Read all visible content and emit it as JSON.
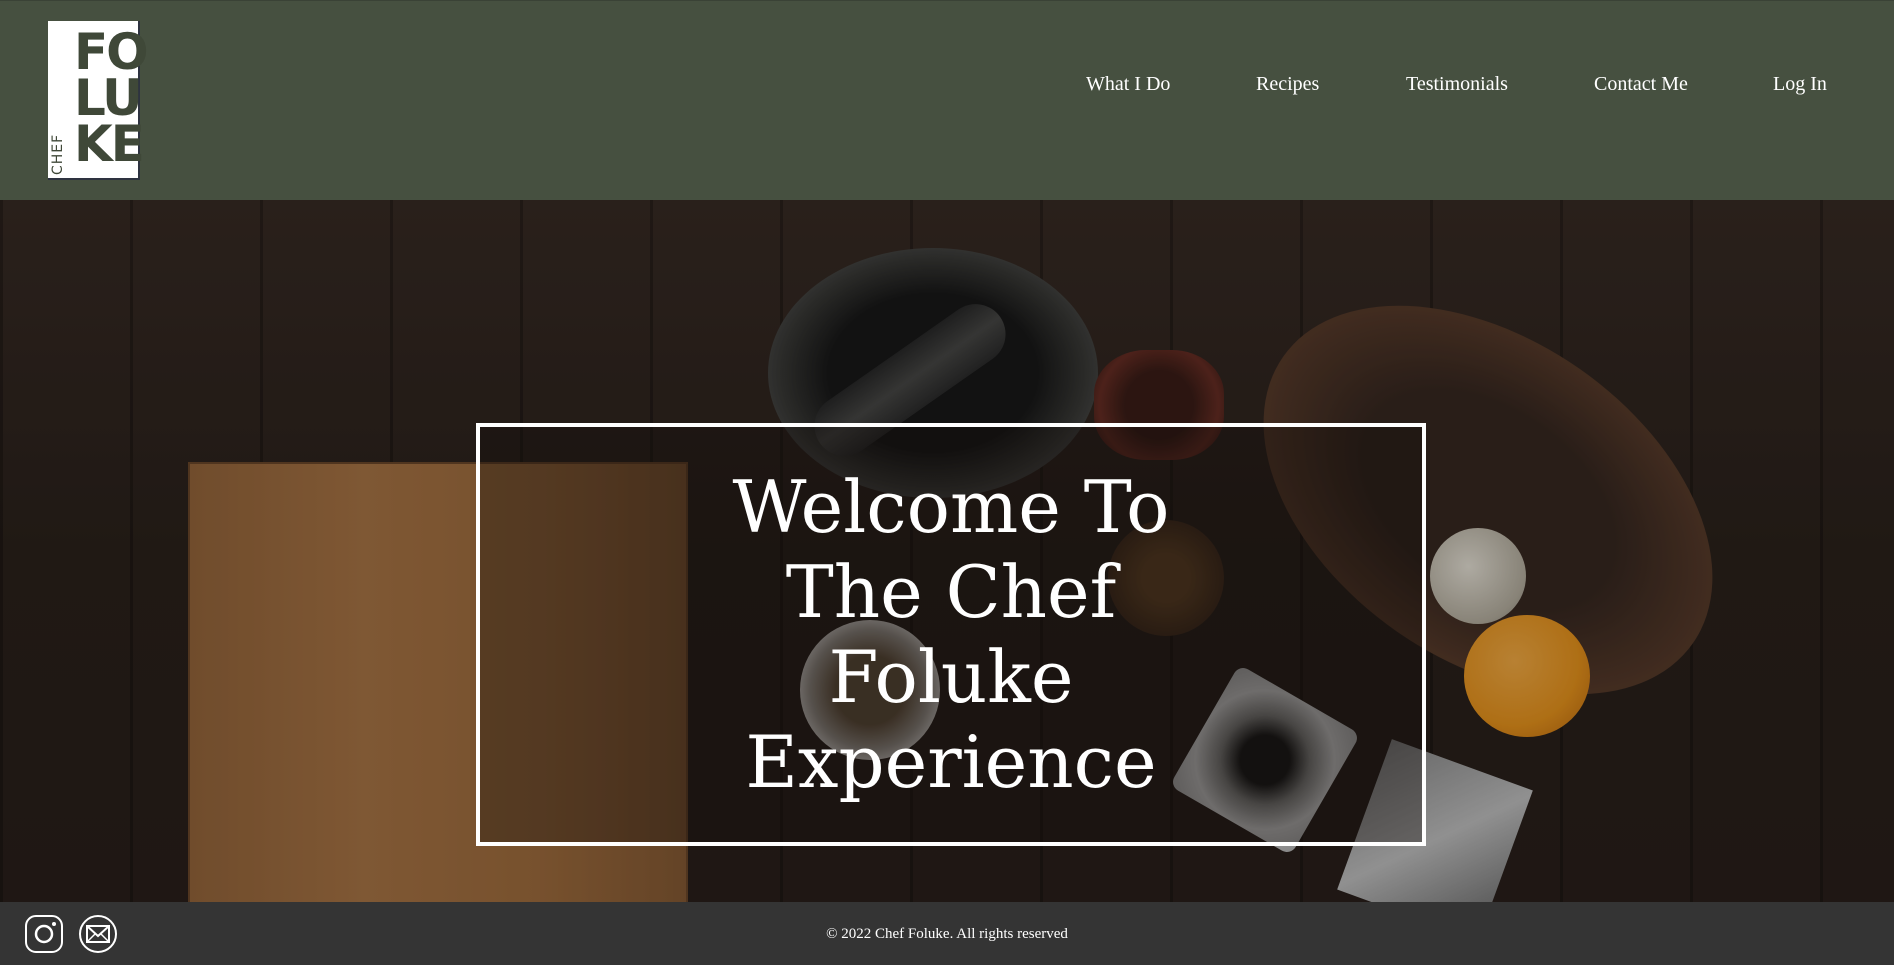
{
  "header": {
    "logo": {
      "line1": "FO",
      "line2": "LU",
      "line3": "KE",
      "small": "CHEF"
    },
    "nav": [
      {
        "label": "What I Do"
      },
      {
        "label": "Recipes"
      },
      {
        "label": "Testimonials"
      },
      {
        "label": "Contact Me"
      },
      {
        "label": "Log In"
      }
    ]
  },
  "hero": {
    "title_lines": [
      "Welcome To",
      "The Chef",
      "Foluke",
      "Experience"
    ]
  },
  "footer": {
    "copyright": "© 2022 Chef Foluke. All rights reserved",
    "icons": [
      "instagram-icon",
      "mail-icon"
    ]
  },
  "colors": {
    "header_bg": "#465040",
    "footer_bg": "#343434",
    "text": "#ffffff"
  }
}
